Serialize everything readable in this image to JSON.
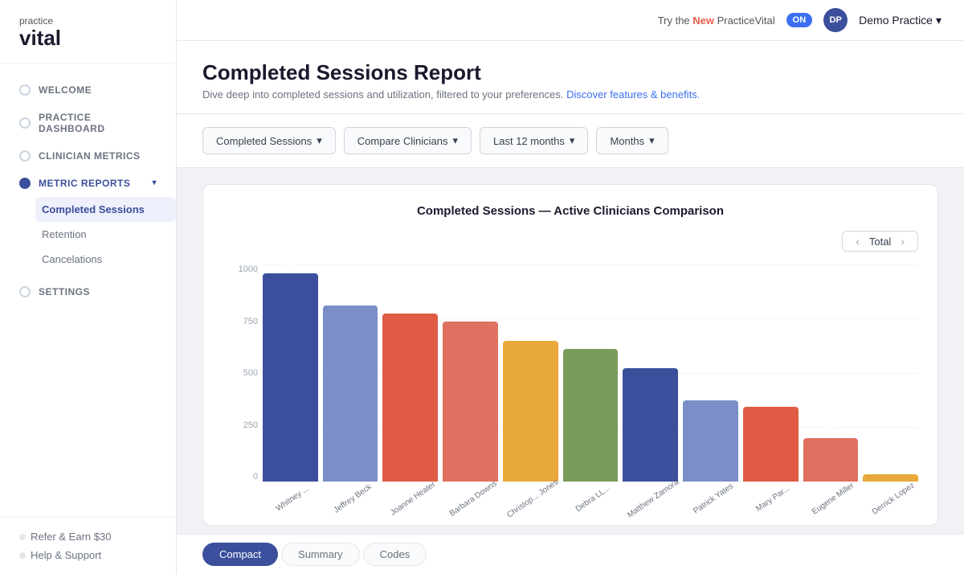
{
  "topbar": {
    "new_text": "Try the",
    "new_highlight": "New",
    "app_name": "PracticeVital",
    "toggle_label": "ON",
    "user_initials": "DP",
    "org_name": "Demo Practice"
  },
  "sidebar": {
    "logo_top": "practice",
    "logo_bottom": "vital",
    "nav_items": [
      {
        "id": "welcome",
        "label": "WELCOME",
        "active": false
      },
      {
        "id": "practice-dashboard",
        "label": "PRACTICE DASHBOARD",
        "active": false
      },
      {
        "id": "clinician-metrics",
        "label": "CLINICIAN METRICS",
        "active": false
      },
      {
        "id": "metric-reports",
        "label": "METRIC REPORTS",
        "active": true,
        "expanded": true
      }
    ],
    "sub_items": [
      {
        "id": "completed-sessions",
        "label": "Completed Sessions",
        "active": true
      },
      {
        "id": "retention",
        "label": "Retention",
        "active": false
      },
      {
        "id": "cancelations",
        "label": "Cancelations",
        "active": false
      }
    ],
    "settings_label": "SETTINGS",
    "footer": {
      "refer": "Refer & Earn $30",
      "help": "Help & Support"
    }
  },
  "page": {
    "title": "Completed Sessions Report",
    "subtitle": "Dive deep into completed sessions and utilization, filtered to your preferences.",
    "link_text": "Discover features & benefits."
  },
  "filters": [
    {
      "id": "metric",
      "label": "Completed Sessions"
    },
    {
      "id": "compare",
      "label": "Compare Clinicians"
    },
    {
      "id": "period",
      "label": "Last 12 months"
    },
    {
      "id": "granularity",
      "label": "Months"
    }
  ],
  "chart": {
    "title": "Completed Sessions — Active Clinicians Comparison",
    "nav_label": "Total",
    "y_labels": [
      "0",
      "250",
      "500",
      "750",
      "1000"
    ],
    "bars": [
      {
        "name": "Whitney ...",
        "value": 997,
        "color": "#3b4f9c"
      },
      {
        "name": "Jeffrey Beck",
        "value": 841,
        "color": "#7b8ec8"
      },
      {
        "name": "Joanne Heater",
        "value": 802,
        "color": "#e05c45"
      },
      {
        "name": "Barbara Downs",
        "value": 764,
        "color": "#e07060"
      },
      {
        "name": "Christop... Jones",
        "value": 672,
        "color": "#e8a83a"
      },
      {
        "name": "Debra LL...",
        "value": 636,
        "color": "#7a9c5a"
      },
      {
        "name": "Matthew Zamora",
        "value": 542,
        "color": "#3b4f9c"
      },
      {
        "name": "Patrick Yates",
        "value": 388,
        "color": "#7b8ec8"
      },
      {
        "name": "Mary Par...",
        "value": 358,
        "color": "#e05c45"
      },
      {
        "name": "Eugene Miller",
        "value": 207,
        "color": "#e07060"
      },
      {
        "name": "Derrick Lopez",
        "value": 33,
        "color": "#e8a83a"
      }
    ]
  },
  "bottom_tabs": [
    {
      "id": "compact",
      "label": "Compact",
      "active": true
    },
    {
      "id": "summary",
      "label": "Summary",
      "active": false
    },
    {
      "id": "codes",
      "label": "Codes",
      "active": false
    }
  ]
}
